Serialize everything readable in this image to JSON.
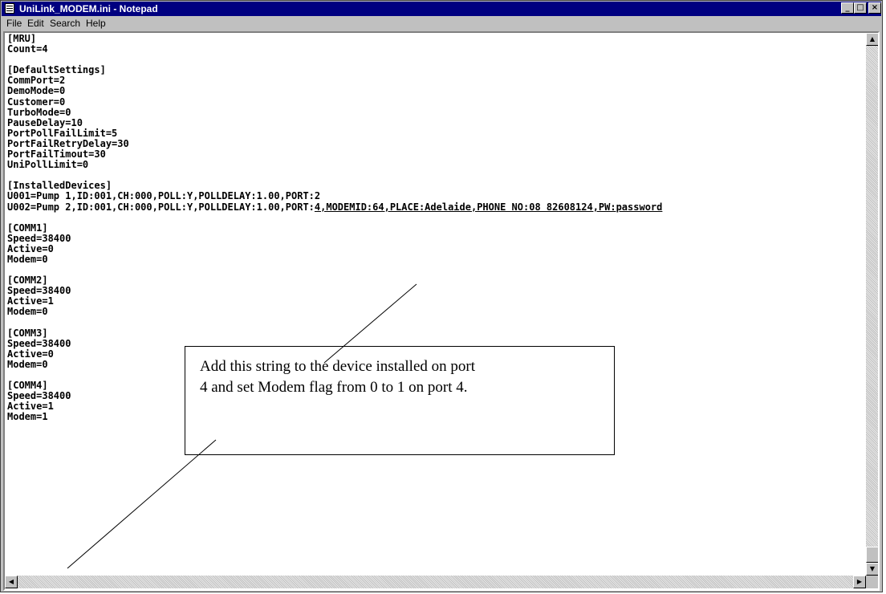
{
  "window": {
    "title": "UniLink_MODEM.ini - Notepad",
    "minimize_glyph": "_",
    "maximize_glyph": "□",
    "close_glyph": "×"
  },
  "menu": {
    "file": "File",
    "edit": "Edit",
    "search": "Search",
    "help": "Help"
  },
  "editor": {
    "lines": [
      "[MRU]",
      "Count=4",
      "",
      "[DefaultSettings]",
      "CommPort=2",
      "DemoMode=0",
      "Customer=0",
      "TurboMode=0",
      "PauseDelay=10",
      "PortPollFailLimit=5",
      "PortFailRetryDelay=30",
      "PortFailTimout=30",
      "UniPollLimit=0",
      "",
      "[InstalledDevices]",
      "U001=Pump 1,ID:001,CH:000,POLL:Y,POLLDELAY:1.00,PORT:2",
      "U002=Pump 2,ID:001,CH:000,POLL:Y,POLLDELAY:1.00,PORT:",
      "",
      "[COMM1]",
      "Speed=38400",
      "Active=0",
      "Modem=0",
      "",
      "[COMM2]",
      "Speed=38400",
      "Active=1",
      "Modem=0",
      "",
      "[COMM3]",
      "Speed=38400",
      "Active=0",
      "Modem=0",
      "",
      "[COMM4]",
      "Speed=38400",
      "Active=1",
      "Modem=1"
    ],
    "underlined_suffix": "4,MODEMID:64,PLACE:Adelaide,PHONE NO:08 82608124,PW:password"
  },
  "callout": {
    "line1": "Add this string to the device installed on port",
    "line2": "4 and set Modem flag from 0 to 1 on port 4."
  },
  "scrollbar": {
    "up_glyph": "▲",
    "down_glyph": "▼",
    "left_glyph": "◀",
    "right_glyph": "▶"
  }
}
